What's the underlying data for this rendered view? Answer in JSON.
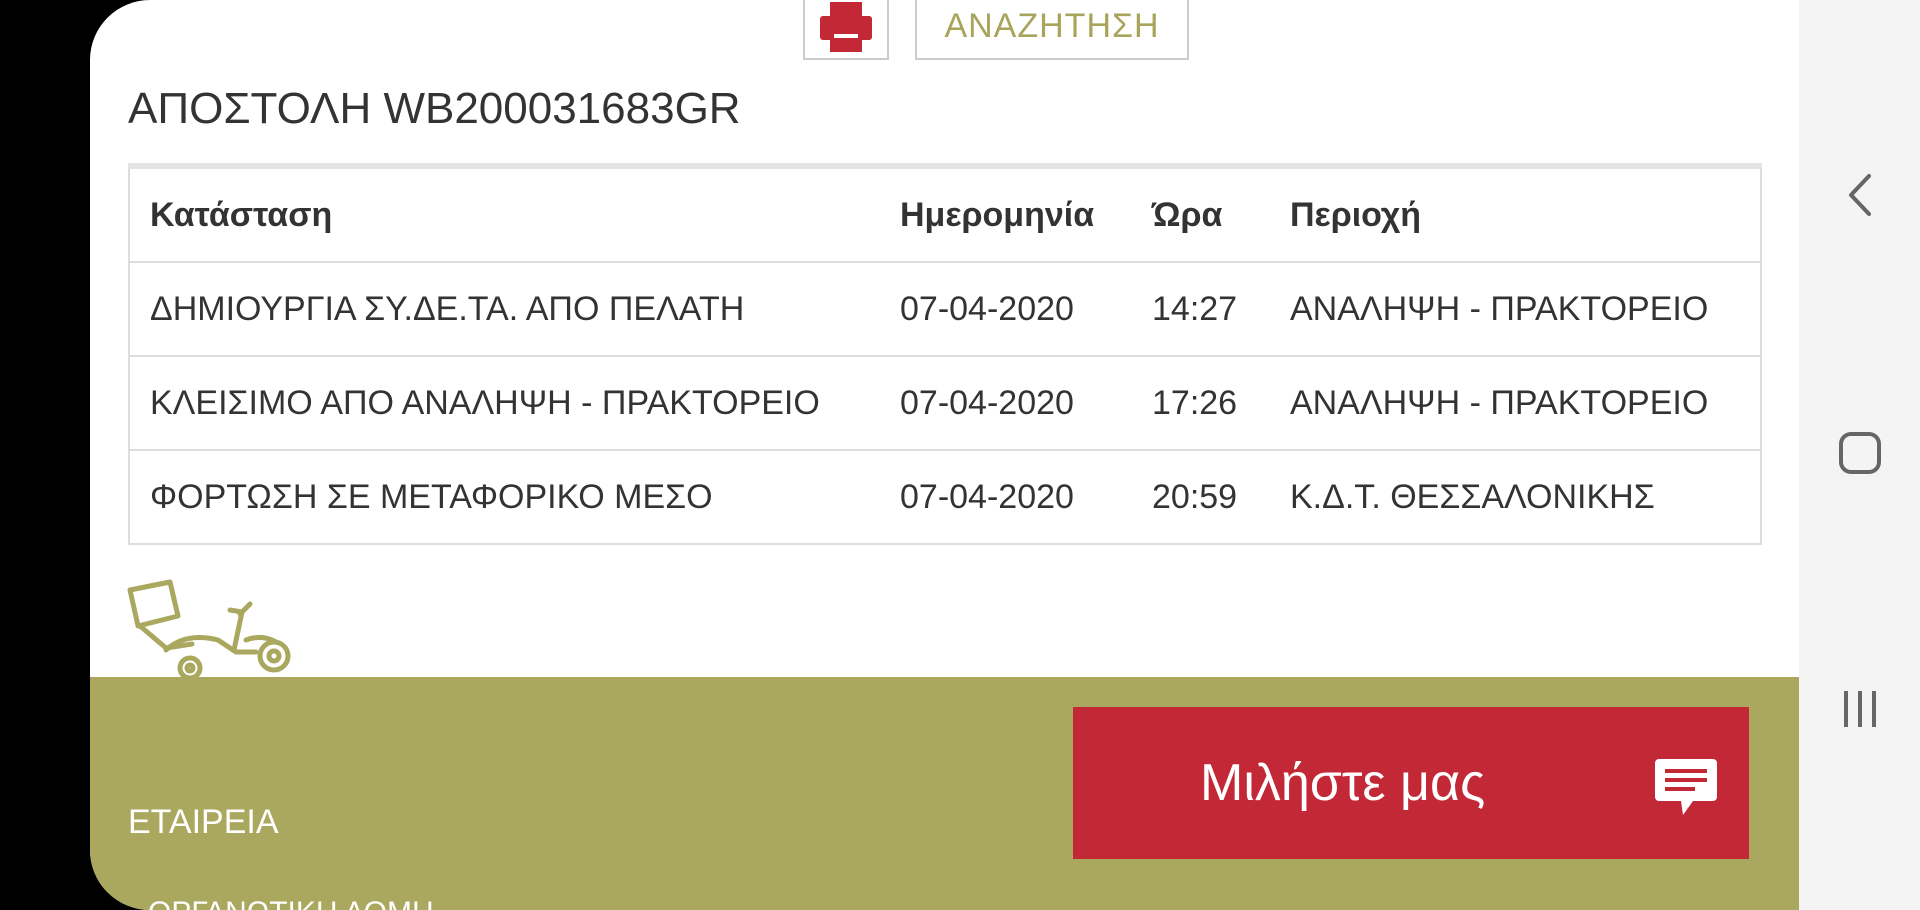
{
  "header": {
    "print_button": "printer-icon",
    "search_label": "ΑΝΑΖΗΤΗΣΗ"
  },
  "shipment": {
    "title": "ΑΠΟΣΤΟΛΗ WB200031683GR"
  },
  "table": {
    "headers": {
      "status": "Κατάσταση",
      "date": "Ημερομηνία",
      "time": "Ώρα",
      "area": "Περιοχή"
    },
    "rows": [
      {
        "status": "ΔΗΜΙΟΥΡΓΙΑ ΣΥ.ΔΕ.ΤΑ. ΑΠΟ ΠΕΛΑΤΗ",
        "date": "07-04-2020",
        "time": "14:27",
        "area": "ΑΝΑΛΗΨΗ - ΠΡΑΚΤΟΡΕΙΟ"
      },
      {
        "status": "ΚΛΕΙΣΙΜΟ ΑΠΟ ΑΝΑΛΗΨΗ - ΠΡΑΚΤΟΡΕΙΟ",
        "date": "07-04-2020",
        "time": "17:26",
        "area": "ΑΝΑΛΗΨΗ - ΠΡΑΚΤΟΡΕΙΟ"
      },
      {
        "status": "ΦΟΡΤΩΣΗ ΣΕ ΜΕΤΑΦΟΡΙΚΟ ΜΕΣΟ",
        "date": "07-04-2020",
        "time": "20:59",
        "area": "Κ.Δ.Τ. ΘΕΣΣΑΛΟΝΙΚΗΣ"
      }
    ]
  },
  "footer": {
    "company_link": "ΕΤΑΙΡΕΙΑ",
    "partial_link": "ΟΡΓΑΝΩΤΙΚΗ ΔΟΜΗ",
    "chat_label": "Μιλήστε μας"
  },
  "colors": {
    "accent_olive": "#aaa85f",
    "brand_red": "#c32836"
  }
}
